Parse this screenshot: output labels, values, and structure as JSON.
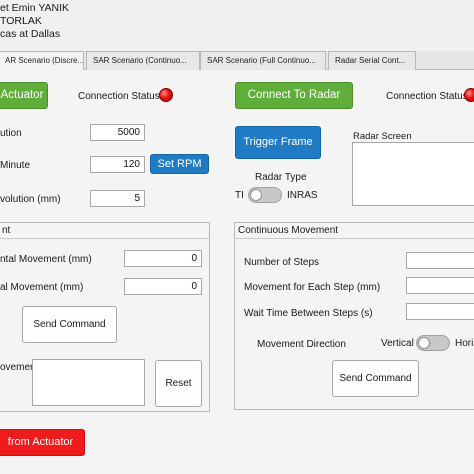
{
  "header": {
    "line1": "et Emin YANIK",
    "line2": "TORLAK",
    "line3": "cas at Dallas"
  },
  "tabs": [
    {
      "label": "AR Scenario (Discre..."
    },
    {
      "label": "SAR Scenario (Continuo..."
    },
    {
      "label": "SAR Scenario (Full Continuo..."
    },
    {
      "label": "Radar Serial Cont..."
    }
  ],
  "actuator": {
    "connect_label": "Actuator",
    "connection_status_label": "Connection Status",
    "fields": [
      {
        "label": "ution",
        "value": "5000"
      },
      {
        "label": "Minute",
        "value": "120"
      },
      {
        "label": "volution (mm)",
        "value": "5"
      }
    ],
    "set_rpm_label": "Set RPM",
    "discrete_group": {
      "title": "nt",
      "rows": [
        {
          "label": "ntal Movement (mm)",
          "value": "0"
        },
        {
          "label": "al Movement (mm)",
          "value": "0"
        }
      ],
      "send_command_label": "Send Command",
      "movement_label": "ovement",
      "reset_label": "Reset"
    },
    "disconnect_label": "from Actuator"
  },
  "radar": {
    "connect_label": "Connect To Radar",
    "connection_status_label": "Connection Status",
    "trigger_label": "Trigger Frame",
    "radar_type_label": "Radar Type",
    "toggle_left": "TI",
    "toggle_right": "INRAS",
    "screen_label": "Radar Screen"
  },
  "continuous_group": {
    "title": "Continuous Movement",
    "rows": [
      {
        "label": "Number of Steps",
        "value": ""
      },
      {
        "label": "Movement for Each Step (mm)",
        "value": ""
      },
      {
        "label": "Wait Time Between Steps (s)",
        "value": ""
      }
    ],
    "direction_label": "Movement Direction",
    "direction_left": "Vertical",
    "direction_right": "Horiz",
    "send_command_label": "Send Command"
  },
  "colors": {
    "connect_green": "#5fae3a",
    "action_blue": "#1f7bc4",
    "disconnect_red": "#ee1c1c",
    "status_lamp_red": "#e81010"
  }
}
